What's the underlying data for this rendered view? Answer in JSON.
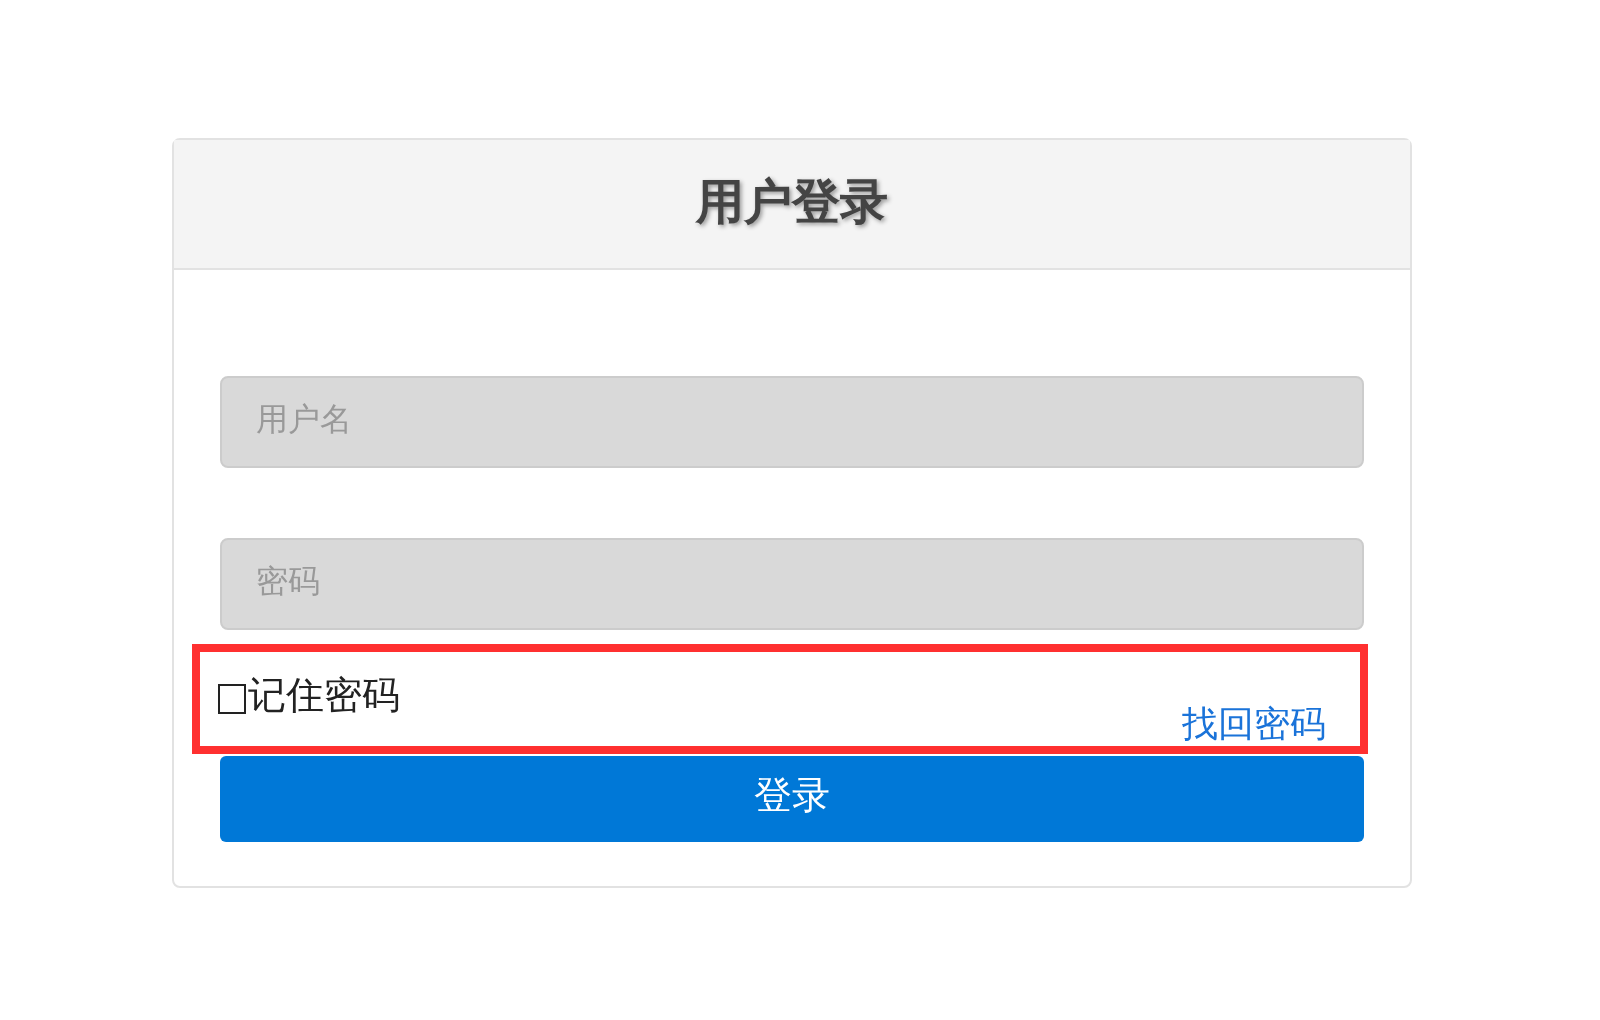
{
  "title": "用户登录",
  "username_field": {
    "placeholder": "用户名"
  },
  "password_field": {
    "placeholder": "密码"
  },
  "remember": {
    "label": "记住密码",
    "checked": false
  },
  "forgot_link": "找回密码",
  "submit_button": "登录"
}
